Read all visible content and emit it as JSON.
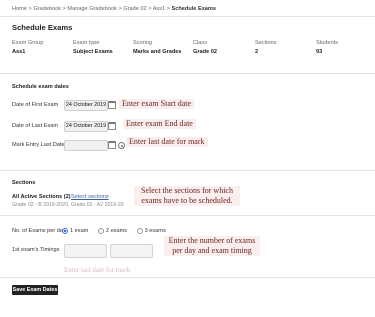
{
  "breadcrumb": {
    "home": "Home",
    "gradebook": "Gradebook",
    "manage": "Manage Gradebook",
    "grade": "Grade 02",
    "assessment": "Ass1",
    "current": "Schedule Exams",
    "sep": ">"
  },
  "page_title": "Schedule Exams",
  "summary": {
    "exam_group_label": "Exam Group",
    "exam_group_value": "Ass1",
    "exam_type_label": "Exam type",
    "exam_type_value": "Subject Exams",
    "scoring_label": "Scoring",
    "scoring_value": "Marks and Grades",
    "class_label": "Class",
    "class_value": "Grade 02",
    "sections_label": "Sections",
    "sections_value": "2",
    "students_label": "Students",
    "students_value": "93"
  },
  "dates": {
    "section_title": "Schedule exam dates",
    "first_label": "Date of First Exam",
    "first_value": "24 October 2019",
    "last_label": "Date of Last Exam",
    "last_value": "24 October 2019",
    "mark_entry_label": "Mark Entry Last Date",
    "mark_entry_value": ""
  },
  "sections": {
    "title": "Sections",
    "all_active": "All Active Sections (2)",
    "select_link": "Select sections",
    "list": "Grade 02 - B 2019-2020, Grade 02 - A2 2019-20"
  },
  "exams_per_day": {
    "label": "No. of Exams per day",
    "options": [
      "1 exam",
      "2 exams",
      "3 exams"
    ],
    "selected": "1 exam"
  },
  "timings": {
    "label": "1st exam's Timings"
  },
  "save_button": "Save Exam Dates",
  "annotations": {
    "start": "Enter exam Start date",
    "end": "Enter exam End date",
    "mark": "Enter last date for mark",
    "sections": "Select the sections for which exams have to be scheduled.",
    "per_day": "Enter the number of exams per day and exam timing",
    "ghost": "Enter last date for mark"
  },
  "colors": {
    "accent": "#3a6fd8",
    "annotation_text": "#6b2420",
    "annotation_bg": "#fbeeee",
    "button_bg": "#222222"
  }
}
